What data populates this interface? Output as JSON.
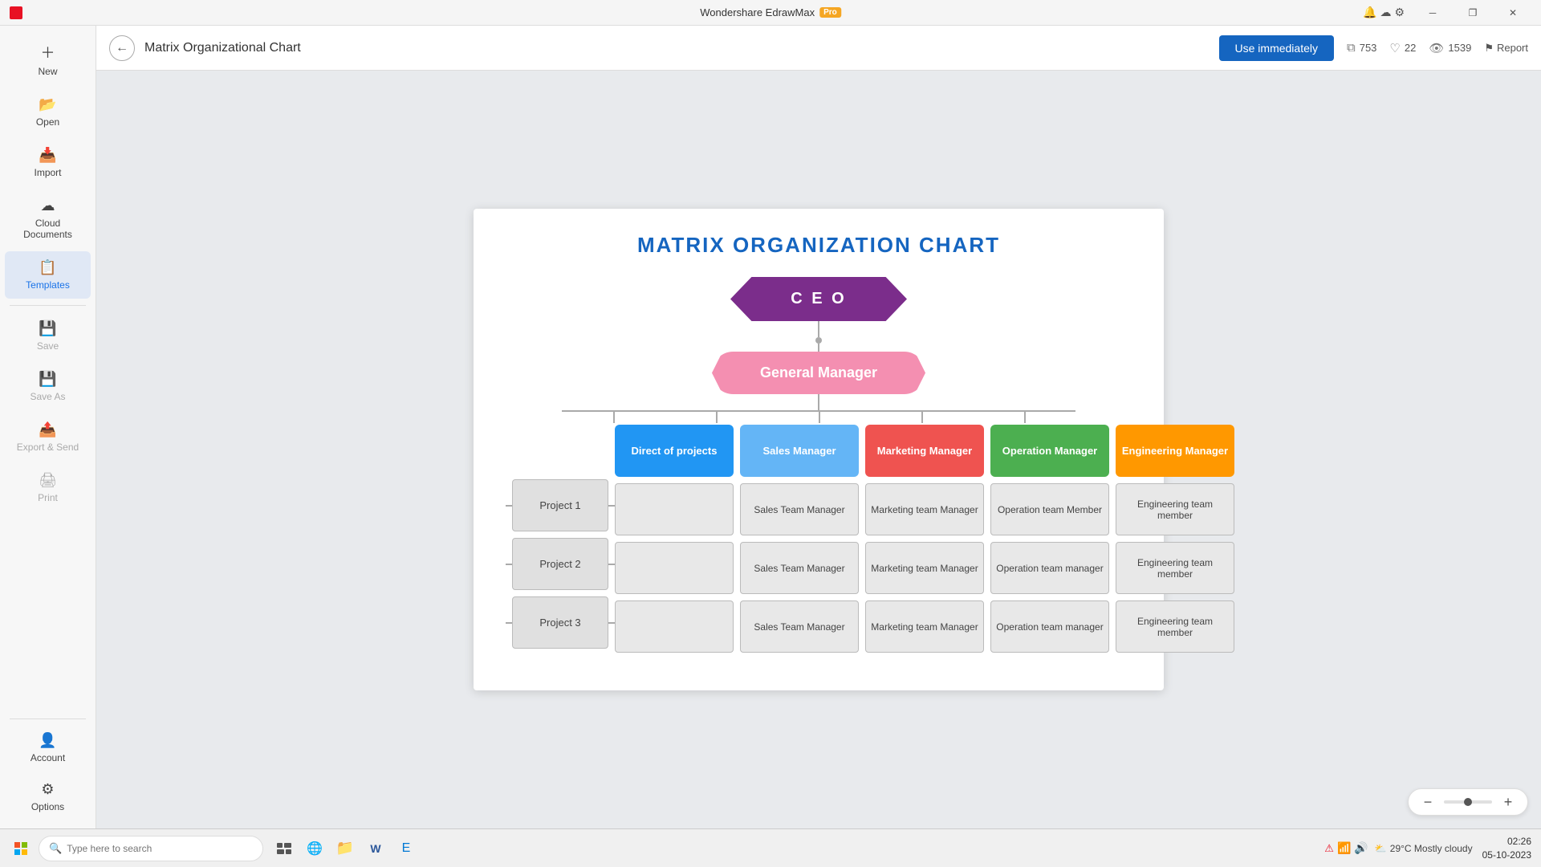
{
  "titleBar": {
    "appName": "Wondershare EdrawMax",
    "proBadge": "Pro",
    "windowControls": {
      "minimize": "─",
      "restore": "❐",
      "close": "✕"
    },
    "topIcons": [
      "🔔",
      "☁",
      "⚙"
    ]
  },
  "sidebar": {
    "backBtn": "←",
    "items": [
      {
        "id": "new",
        "label": "New",
        "icon": "＋",
        "active": false,
        "disabled": false
      },
      {
        "id": "open",
        "label": "Open",
        "icon": "📂",
        "active": false,
        "disabled": false
      },
      {
        "id": "import",
        "label": "Import",
        "icon": "📥",
        "active": false,
        "disabled": false
      },
      {
        "id": "cloud",
        "label": "Cloud Documents",
        "icon": "☁",
        "active": false,
        "disabled": false
      },
      {
        "id": "templates",
        "label": "Templates",
        "icon": "📋",
        "active": true,
        "disabled": false
      },
      {
        "id": "save",
        "label": "Save",
        "icon": "💾",
        "active": false,
        "disabled": true
      },
      {
        "id": "saveas",
        "label": "Save As",
        "icon": "💾",
        "active": false,
        "disabled": true
      },
      {
        "id": "export",
        "label": "Export & Send",
        "icon": "📤",
        "active": false,
        "disabled": true
      },
      {
        "id": "print",
        "label": "Print",
        "icon": "🖨",
        "active": false,
        "disabled": true
      }
    ],
    "bottomItems": [
      {
        "id": "account",
        "label": "Account",
        "icon": "👤"
      },
      {
        "id": "options",
        "label": "Options",
        "icon": "⚙"
      }
    ]
  },
  "header": {
    "title": "Matrix Organizational Chart",
    "useImmediately": "Use immediately",
    "stats": {
      "copies": "753",
      "likes": "22",
      "views": "1539"
    },
    "report": "Report"
  },
  "diagram": {
    "title": "MATRIX ORGANIZATION CHART",
    "ceo": "C E O",
    "gm": "General Manager",
    "managers": [
      {
        "label": "Direct of projects",
        "color": "blue"
      },
      {
        "label": "Sales Manager",
        "color": "lightblue"
      },
      {
        "label": "Marketing Manager",
        "color": "red"
      },
      {
        "label": "Operation Manager",
        "color": "green"
      },
      {
        "label": "Engineering Manager",
        "color": "orange"
      }
    ],
    "projects": [
      "Project 1",
      "Project 2",
      "Project 3"
    ],
    "gridData": [
      [
        "Sales Team Manager",
        "Marketing team Manager",
        "Operation team Member",
        "Engineering team member"
      ],
      [
        "Sales Team Manager",
        "Marketing team Manager",
        "Operation team manager",
        "Engineering team member"
      ],
      [
        "Sales Team Manager",
        "Marketing team Manager",
        "Operation team manager",
        "Engineering team member"
      ]
    ]
  },
  "zoom": {
    "minusLabel": "−",
    "plusLabel": "+"
  },
  "taskbar": {
    "searchPlaceholder": "Type here to search",
    "weather": "29°C  Mostly cloudy",
    "time": "02:26",
    "date": "05-10-2023",
    "apps": [
      "⊞",
      "🔍",
      "📋",
      "🌐",
      "📁",
      "W",
      "E"
    ]
  }
}
